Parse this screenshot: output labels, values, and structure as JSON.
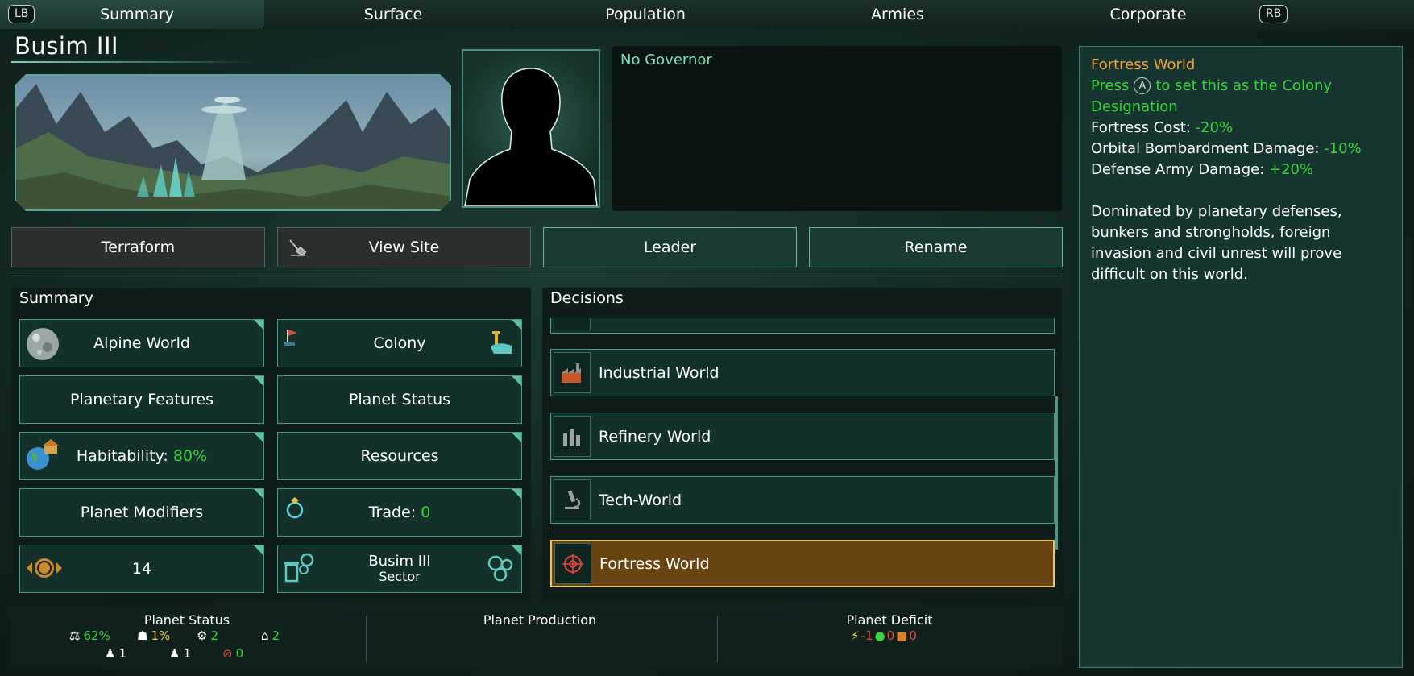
{
  "tabs": {
    "lb": "LB",
    "rb": "RB",
    "items": [
      "Summary",
      "Surface",
      "Population",
      "Armies",
      "Corporate"
    ],
    "active": "Summary"
  },
  "planet": {
    "name": "Busim III"
  },
  "governor": {
    "text": "No Governor"
  },
  "actions": {
    "terraform": "Terraform",
    "view_site": "View Site",
    "leader": "Leader",
    "rename": "Rename"
  },
  "summary": {
    "heading": "Summary",
    "planet_type": "Alpine World",
    "colony": "Colony",
    "features": "Planetary Features",
    "status": "Planet Status",
    "habitability_label": "Habitability:",
    "habitability_value": "80%",
    "resources": "Resources",
    "modifiers": "Planet Modifiers",
    "trade_label": "Trade:",
    "trade_value": "0",
    "planet_size": "14",
    "sector_name": "Busim III",
    "sector_label": "Sector"
  },
  "decisions": {
    "heading": "Decisions",
    "items": [
      "Industrial World",
      "Refinery World",
      "Tech-World",
      "Fortress World"
    ],
    "selected": "Fortress World"
  },
  "info": {
    "title": "Fortress World",
    "press_before": "Press",
    "press_button": "A",
    "press_after": "to set this as the Colony Designation",
    "effects": [
      {
        "label": "Fortress Cost:",
        "value": "-20%"
      },
      {
        "label": "Orbital Bombardment Damage:",
        "value": "-10%"
      },
      {
        "label": "Defense Army Damage:",
        "value": "+20%"
      }
    ],
    "description": "Dominated by planetary defenses, bunkers and strongholds, foreign invasion and civil unrest will prove difficult on this world."
  },
  "bottom": {
    "status_title": "Planet Status",
    "production_title": "Planet Production",
    "deficit_title": "Planet Deficit",
    "status": {
      "stability": "62%",
      "crime": "1%",
      "amenities": "2",
      "housing": "2",
      "pop_a": "1",
      "pop_b": "1",
      "unemployed": "0"
    },
    "deficit": {
      "energy": "-1",
      "food": "0",
      "goods": "0"
    }
  },
  "colors": {
    "accent": "#4a9a86",
    "positive": "#38d43a",
    "highlight": "#f2a33b",
    "selected_bg": "#684412"
  }
}
